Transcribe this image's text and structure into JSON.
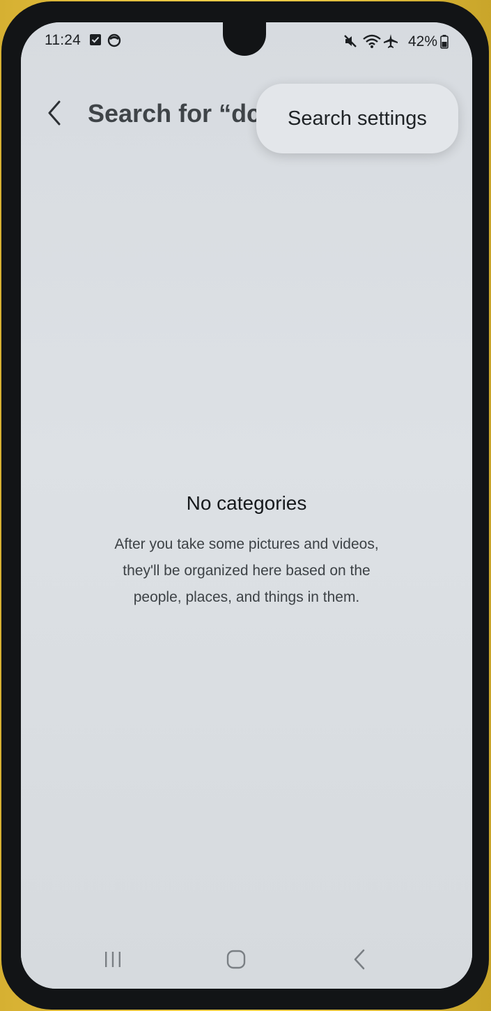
{
  "status_bar": {
    "time": "11:24",
    "battery_percent": "42%",
    "icons": [
      "checkbox-notification-icon",
      "app-notification-icon",
      "mute-icon",
      "wifi-icon",
      "airplane-mode-icon",
      "battery-icon"
    ]
  },
  "header": {
    "title": "Search for “dc"
  },
  "popup_menu": {
    "item_label": "Search settings"
  },
  "empty_state": {
    "title": "No categories",
    "description": "After you take some pictures and videos,\nthey'll be organized here based on the\npeople, places, and things in them."
  },
  "navigation": {
    "buttons": [
      "recent-apps-icon",
      "home-icon",
      "back-icon"
    ]
  },
  "colors": {
    "screen_background": "#d8dde2",
    "popup_background": "#e3e6ea",
    "text_primary": "#16191c",
    "text_secondary": "#3d4246",
    "phone_frame": "#121416",
    "backdrop": "#e8c23a"
  }
}
